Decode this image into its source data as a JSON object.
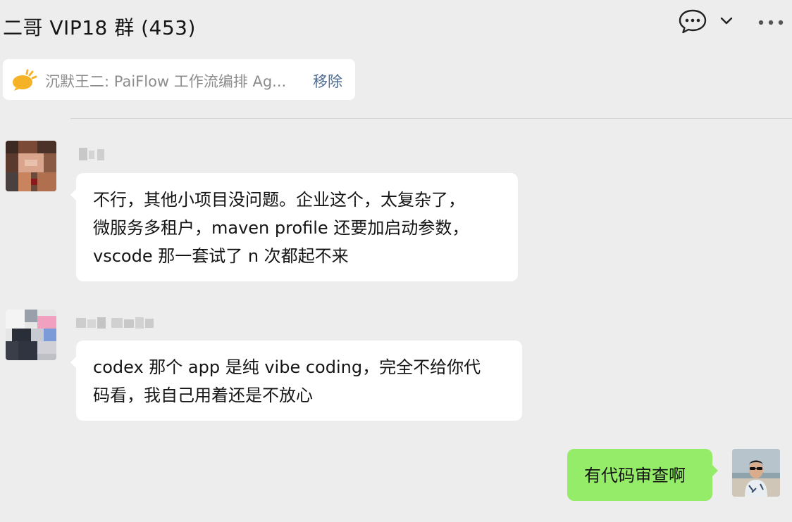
{
  "header": {
    "title": "二哥 VIP18 群 (453)"
  },
  "pinned": {
    "text": "沉默王二: PaiFlow 工作流编排 Ag...",
    "remove_label": "移除",
    "icon": "broadcast-icon"
  },
  "messages": [
    {
      "sender": "other",
      "lines": [
        "不行，其他小项目没问题。企业这个，太复杂了，",
        "微服务多租户，maven profile 还要加启动参数，",
        "vscode 那一套试了 n 次都起不来"
      ]
    },
    {
      "sender": "other",
      "lines": [
        "codex 那个 app 是纯 vibe coding，完全不给你代",
        "码看，我自己用着还是不放心"
      ]
    },
    {
      "sender": "me",
      "lines": [
        "有代码审查啊"
      ]
    }
  ],
  "colors": {
    "background": "#ededed",
    "my_bubble": "#95ec69",
    "other_bubble": "#ffffff",
    "link": "#4c6a92"
  }
}
